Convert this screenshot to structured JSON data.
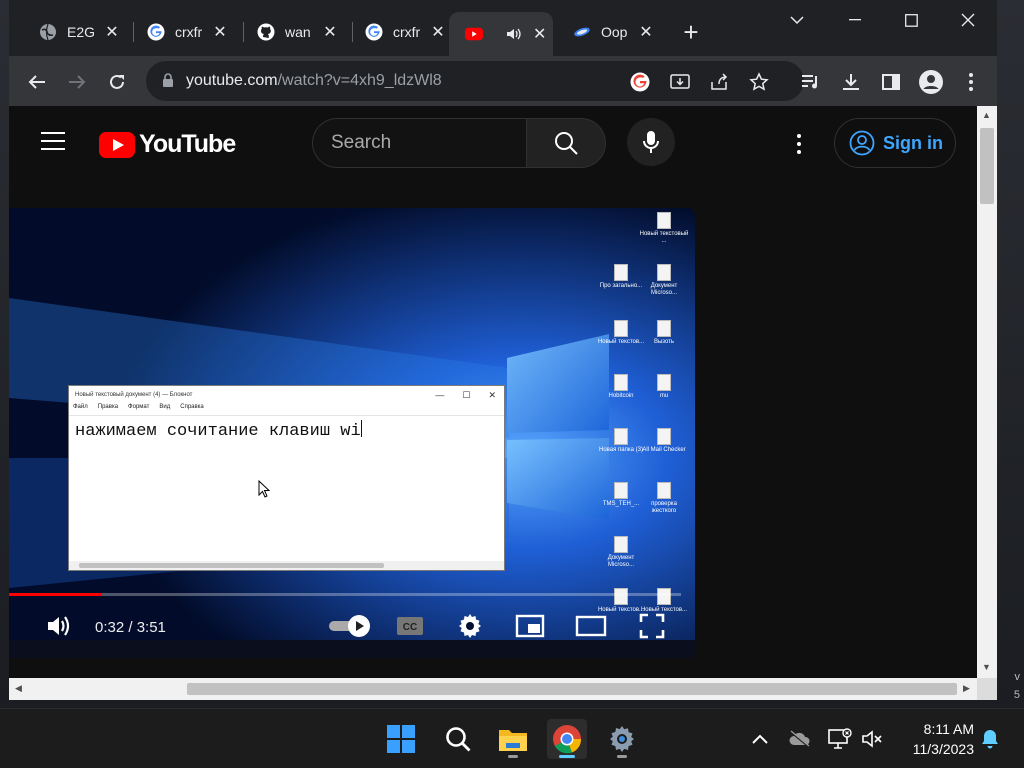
{
  "desktop": {
    "right_text": [
      "v",
      "5"
    ]
  },
  "tabs": [
    {
      "title": "E2G",
      "favicon": "globe-icon",
      "active": false
    },
    {
      "title": "crxfr",
      "favicon": "google-icon",
      "active": false
    },
    {
      "title": "wan",
      "favicon": "github-icon",
      "active": false
    },
    {
      "title": "crxfr",
      "favicon": "google-icon",
      "active": false
    },
    {
      "title": "",
      "favicon": "youtube-icon",
      "active": true,
      "audio": "speaker-icon"
    },
    {
      "title": "Oop",
      "favicon": "edge-icon",
      "active": false
    }
  ],
  "toolbar": {
    "url_host": "youtube.com",
    "url_path": "/watch?v=4xh9_ldzWl8"
  },
  "youtube": {
    "logo_text": "YouTube",
    "search_placeholder": "Search",
    "sign_in_label": "Sign in"
  },
  "video": {
    "notepad_title": "Новый текстовый документ (4) — Блокнот",
    "notepad_menu": [
      "Файл",
      "Правка",
      "Формат",
      "Вид",
      "Справка"
    ],
    "notepad_text": "нажимаем сочитание клавиш wi",
    "desktop_icons": [
      "Новый текстовый ...",
      "Про загально...",
      "Документ Microso...",
      "Новый текстов...",
      "Вызоть",
      "Hobitcoin",
      "mu",
      "Новая папка (3)",
      "All Mail Checker",
      "TMS_TEH_...",
      "проверка жесткого",
      "Документ Microso...",
      "Новый текстов...",
      "Новый текстов..."
    ],
    "current_time": "0:32",
    "duration": "3:51",
    "time_display": "0:32 / 3:51",
    "progress_fraction": 0.139,
    "loaded_fraction": 0.131
  },
  "taskbar": {
    "apps": [
      "windows-start-icon",
      "search-icon",
      "file-explorer-icon",
      "chrome-icon",
      "settings-icon"
    ],
    "time": "8:11 AM",
    "date": "11/3/2023"
  },
  "colors": {
    "youtube_red": "#ff0000",
    "sign_in_blue": "#3ea6ff",
    "taskbar_accent": "#60cdff"
  }
}
